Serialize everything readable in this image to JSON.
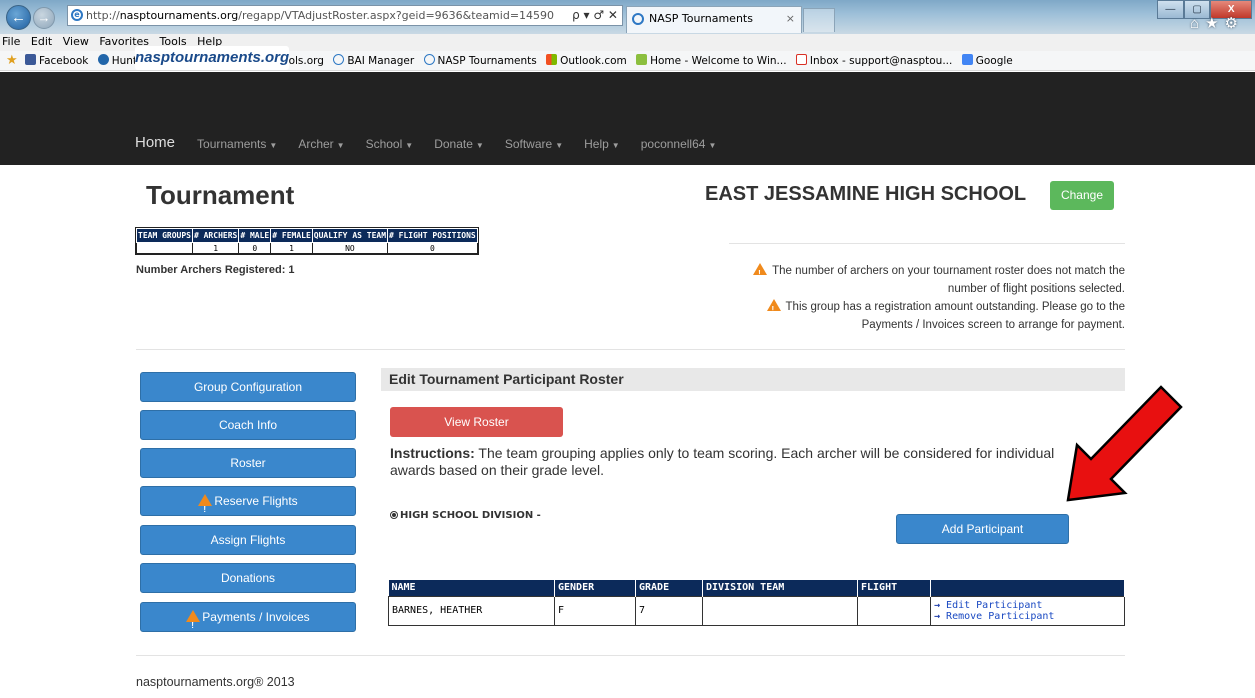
{
  "browser": {
    "address": {
      "prefix": "http://",
      "domain": "nasptournaments.org",
      "path": "/regapp/VTAdjustRoster.aspx?geid=9636&teamid=14590",
      "controls": "ρ ▾ ♂ ✕"
    },
    "tab_title": "NASP Tournaments",
    "tab_close": "×",
    "menu": [
      "File",
      "Edit",
      "View",
      "Favorites",
      "Tools",
      "Help"
    ],
    "favorites": [
      {
        "label": "Facebook",
        "color": "#3b5998"
      },
      {
        "label": "Hunter Ed - Admin",
        "color": "#2266aa"
      },
      {
        "label": "NASP Schools.org",
        "color": "#2e78c4"
      },
      {
        "label": "BAI Manager",
        "color": "#2e78c4"
      },
      {
        "label": "NASP Tournaments",
        "color": "#2e78c4"
      },
      {
        "label": "Outlook.com",
        "color": "#f25022"
      },
      {
        "label": "Home - Welcome to Win...",
        "color": "#8cbf3f"
      },
      {
        "label": "Inbox - support@nasptou...",
        "color": "#d93025"
      },
      {
        "label": "Google",
        "color": "#4285f4"
      }
    ],
    "window_controls": [
      "—",
      "▢",
      "X"
    ]
  },
  "site": {
    "logo": "nasptournaments.org",
    "nav": {
      "home": "Home",
      "items": [
        "Tournaments",
        "Archer",
        "School",
        "Donate",
        "Software",
        "Help",
        "poconnell64"
      ]
    }
  },
  "page": {
    "title": "Tournament",
    "school_name": "EAST JESSAMINE HIGH SCHOOL",
    "change_label": "Change",
    "stats": {
      "headers": [
        "TEAM GROUPS",
        "# ARCHERS",
        "# MALE",
        "# FEMALE",
        "QUALIFY AS TEAM",
        "# FLIGHT POSITIONS"
      ],
      "values": [
        "",
        "1",
        "0",
        "1",
        "NO",
        "0"
      ]
    },
    "archers_registered": "Number Archers Registered: 1",
    "warnings": [
      {
        "line1": "The number of archers on your tournament roster does not match the",
        "line2": "number of flight positions selected."
      },
      {
        "line1": "This group has a registration amount outstanding. Please go to the",
        "line2": "Payments / Invoices screen to arrange for payment."
      }
    ],
    "sidebar": [
      "Group Configuration",
      "Coach Info",
      "Roster",
      "Reserve Flights",
      "Assign Flights",
      "Donations",
      "Payments / Invoices"
    ],
    "edit_heading": "Edit Tournament Participant Roster",
    "view_roster_label": "View Roster",
    "instructions_label": "Instructions:",
    "instructions_text": " The team grouping applies only to team scoring. Each archer will be considered for individual awards based on their grade level.",
    "division": "HIGH SCHOOL DIVISION -",
    "add_participant_label": "Add Participant",
    "roster": {
      "headers": [
        "NAME",
        "GENDER",
        "GRADE",
        "DIVISION TEAM",
        "FLIGHT",
        ""
      ],
      "rows": [
        {
          "name": "BARNES, HEATHER",
          "gender": "F",
          "grade": "7",
          "division_team": "",
          "flight": "",
          "edit": "Edit Participant",
          "remove": "Remove Participant"
        }
      ]
    },
    "footer": "nasptournaments.org® 2013"
  },
  "colors": {
    "nav_bg": "#222222",
    "primary_button": "#3a87cc",
    "danger_button": "#d9534f",
    "success_button": "#5cb85c",
    "table_header": "#0c2a5a",
    "annotation_arrow": "#e81010"
  }
}
